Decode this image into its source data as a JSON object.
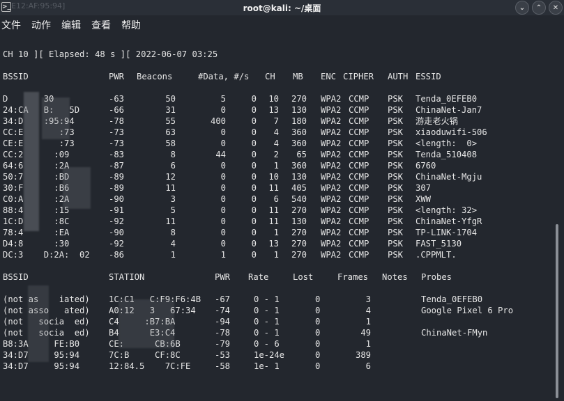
{
  "window": {
    "title": "root@kali: ~/桌面",
    "ghost_text": "E12:AF:95:94]"
  },
  "menu": [
    "文件",
    "动作",
    "编辑",
    "查看",
    "帮助"
  ],
  "status_line": "CH 10 ][ Elapsed: 48 s ][ 2022-06-07 03:25",
  "ap_headers": {
    "bssid": "BSSID",
    "pwr": "PWR",
    "beacons": "Beacons",
    "data": "#Data, #/s",
    "ch": "CH",
    "mb": "MB",
    "enc": "ENC",
    "cipher": "CIPHER",
    "auth": "AUTH",
    "essid": "ESSID"
  },
  "ap_rows": [
    {
      "bssid": "D       30",
      "pwr": "-63",
      "beacons": "50",
      "data": "5",
      "s": "0",
      "ch": "10",
      "mb": "270",
      "enc": "WPA2",
      "cipher": "CCMP",
      "auth": "PSK",
      "essid": "Tenda_0EFEB0"
    },
    {
      "bssid": "24:CA   B:   5D",
      "pwr": "-66",
      "beacons": "31",
      "data": "0",
      "s": "0",
      "ch": "13",
      "mb": "130",
      "enc": "WPA2",
      "cipher": "CCMP",
      "auth": "PSK",
      "essid": "ChinaNet-Jan7"
    },
    {
      "bssid": "34:D    :95:94",
      "pwr": "-78",
      "beacons": "55",
      "data": "400",
      "s": "0",
      "ch": "7",
      "mb": "180",
      "enc": "WPA2",
      "cipher": "CCMP",
      "auth": "PSK",
      "essid": "游走老火锅"
    },
    {
      "bssid": "CC:E       :73",
      "pwr": "-73",
      "beacons": "63",
      "data": "0",
      "s": "0",
      "ch": "4",
      "mb": "360",
      "enc": "WPA2",
      "cipher": "CCMP",
      "auth": "PSK",
      "essid": "xiaoduwifi-506"
    },
    {
      "bssid": "CE:E       :73",
      "pwr": "-73",
      "beacons": "58",
      "data": "0",
      "s": "0",
      "ch": "4",
      "mb": "360",
      "enc": "WPA2",
      "cipher": "CCMP",
      "auth": "PSK",
      "essid": "<length:  0>"
    },
    {
      "bssid": "CC:2      :09",
      "pwr": "-83",
      "beacons": "8",
      "data": "44",
      "s": "0",
      "ch": "2",
      "mb": "65",
      "enc": "WPA2",
      "cipher": "CCMP",
      "auth": "PSK",
      "essid": "Tenda_510408"
    },
    {
      "bssid": "64:6      :2A",
      "pwr": "-87",
      "beacons": "6",
      "data": "0",
      "s": "0",
      "ch": "1",
      "mb": "360",
      "enc": "WPA2",
      "cipher": "CCMP",
      "auth": "PSK",
      "essid": "6760"
    },
    {
      "bssid": "50:7      :BD",
      "pwr": "-89",
      "beacons": "12",
      "data": "0",
      "s": "0",
      "ch": "10",
      "mb": "130",
      "enc": "WPA2",
      "cipher": "CCMP",
      "auth": "PSK",
      "essid": "ChinaNet-Mgju"
    },
    {
      "bssid": "30:F      :B6",
      "pwr": "-89",
      "beacons": "11",
      "data": "0",
      "s": "0",
      "ch": "11",
      "mb": "405",
      "enc": "WPA2",
      "cipher": "CCMP",
      "auth": "PSK",
      "essid": "307"
    },
    {
      "bssid": "C0:A      :2A",
      "pwr": "-90",
      "beacons": "3",
      "data": "0",
      "s": "0",
      "ch": "6",
      "mb": "540",
      "enc": "WPA2",
      "cipher": "CCMP",
      "auth": "PSK",
      "essid": "XWW"
    },
    {
      "bssid": "88:4      :15",
      "pwr": "-91",
      "beacons": "5",
      "data": "0",
      "s": "0",
      "ch": "11",
      "mb": "270",
      "enc": "WPA2",
      "cipher": "CCMP",
      "auth": "PSK",
      "essid": "<length: 32>"
    },
    {
      "bssid": "1C:D      :8C",
      "pwr": "-92",
      "beacons": "11",
      "data": "0",
      "s": "0",
      "ch": "11",
      "mb": "130",
      "enc": "WPA2",
      "cipher": "CCMP",
      "auth": "PSK",
      "essid": "ChinaNet-YfgR"
    },
    {
      "bssid": "78:4      :EA",
      "pwr": "-90",
      "beacons": "8",
      "data": "0",
      "s": "0",
      "ch": "1",
      "mb": "270",
      "enc": "WPA2",
      "cipher": "CCMP",
      "auth": "PSK",
      "essid": "TP-LINK-1704"
    },
    {
      "bssid": "D4:8      :30",
      "pwr": "-92",
      "beacons": "4",
      "data": "0",
      "s": "0",
      "ch": "13",
      "mb": "270",
      "enc": "WPA2",
      "cipher": "CCMP",
      "auth": "PSK",
      "essid": "FAST_5130"
    },
    {
      "bssid": "DC:3    D:2A:  02",
      "pwr": "-86",
      "beacons": "1",
      "data": "1",
      "s": "0",
      "ch": "1",
      "mb": "270",
      "enc": "WPA2",
      "cipher": "CCMP",
      "auth": "PSK",
      "essid": ".CPPMLT."
    }
  ],
  "st_headers": {
    "bssid": "BSSID",
    "station": "STATION",
    "pwr": "PWR",
    "rate": "Rate",
    "lost": "Lost",
    "frames": "Frames",
    "notes": "Notes",
    "probes": "Probes"
  },
  "st_rows": [
    {
      "bssid": "(not as    iated)",
      "station": "1C:C1   C:F9:F6:4B",
      "pwr": "-67",
      "rate": "0 - 1",
      "lost": "0",
      "frames": "3",
      "probes": "Tenda_0EFEB0"
    },
    {
      "bssid": "(not asso   ated)",
      "station": "A0:12   3   67:34",
      "pwr": "-74",
      "rate": "0 - 1",
      "lost": "0",
      "frames": "4",
      "probes": "Google Pixel 6 Pro"
    },
    {
      "bssid": "(not   socia  ed)",
      "station": "C4     :B7:BA",
      "pwr": "-94",
      "rate": "0 - 1",
      "lost": "0",
      "frames": "1",
      "probes": ""
    },
    {
      "bssid": "(not   socia  ed)",
      "station": "B4      E3:C4",
      "pwr": "-78",
      "rate": "0 - 1",
      "lost": "0",
      "frames": "49",
      "probes": "ChinaNet-FMyn"
    },
    {
      "bssid": "B8:3A     FE:B0",
      "station": "CE:      CB:6B",
      "pwr": "-79",
      "rate": "0 - 6",
      "lost": "0",
      "frames": "1",
      "probes": ""
    },
    {
      "bssid": "34:D7     95:94",
      "station": "7C:B     CF:8C",
      "pwr": "-53",
      "rate": "1e-24e",
      "lost": "0",
      "frames": "389",
      "probes": ""
    },
    {
      "bssid": "34:D7     95:94",
      "station": "12:84.5    7C:FE",
      "pwr": "-58",
      "rate": "1e- 1",
      "lost": "0",
      "frames": "6",
      "probes": ""
    }
  ]
}
